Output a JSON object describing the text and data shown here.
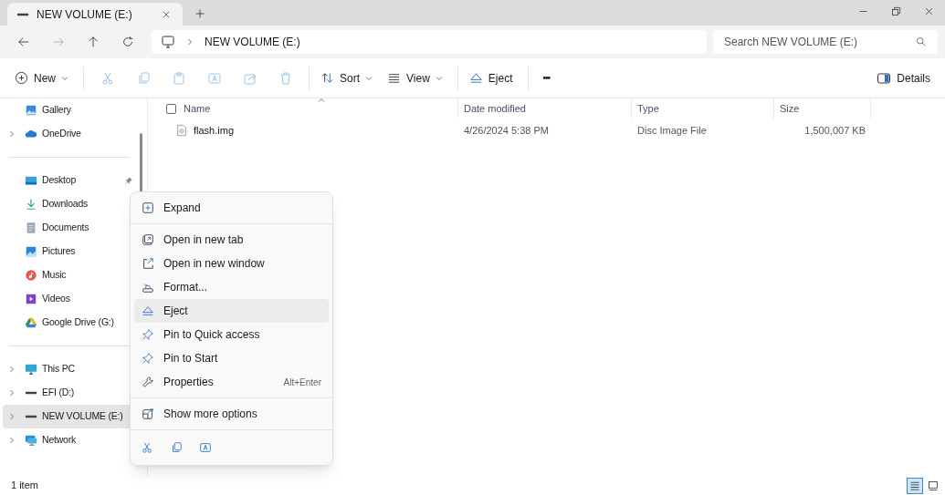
{
  "tabs": [
    {
      "label": "NEW VOLUME (E:)",
      "selected": true
    }
  ],
  "address": {
    "crumbs": [
      "NEW VOLUME (E:)"
    ]
  },
  "search": {
    "placeholder": "Search NEW VOLUME (E:)"
  },
  "toolbar": [
    {
      "kind": "labeled",
      "label": "New",
      "dropdown": true,
      "disabled": false
    },
    {
      "kind": "divider"
    },
    {
      "kind": "icon",
      "disabled": true
    },
    {
      "kind": "icon",
      "disabled": true
    },
    {
      "kind": "icon",
      "disabled": true
    },
    {
      "kind": "icon",
      "disabled": true
    },
    {
      "kind": "icon",
      "disabled": true
    },
    {
      "kind": "icon",
      "disabled": true
    },
    {
      "kind": "divider"
    },
    {
      "kind": "labeled",
      "label": "Sort",
      "dropdown": true,
      "disabled": false
    },
    {
      "kind": "labeled",
      "label": "View",
      "dropdown": true,
      "disabled": false
    },
    {
      "kind": "divider"
    },
    {
      "kind": "labeled",
      "label": "Eject",
      "dropdown": false,
      "disabled": false
    },
    {
      "kind": "divider"
    },
    {
      "kind": "more",
      "label": "•••"
    }
  ],
  "details_button": {
    "label": "Details"
  },
  "sidebar": {
    "groups": [
      [
        {
          "label": "Gallery",
          "expandable": false,
          "pinned": false,
          "selected": false
        },
        {
          "label": "OneDrive",
          "expandable": true,
          "pinned": false,
          "selected": false
        }
      ],
      [
        {
          "label": "Desktop",
          "expandable": false,
          "pinned": true,
          "selected": false
        },
        {
          "label": "Downloads",
          "expandable": false,
          "pinned": false,
          "selected": false
        },
        {
          "label": "Documents",
          "expandable": false,
          "pinned": false,
          "selected": false
        },
        {
          "label": "Pictures",
          "expandable": false,
          "pinned": false,
          "selected": false
        },
        {
          "label": "Music",
          "expandable": false,
          "pinned": false,
          "selected": false
        },
        {
          "label": "Videos",
          "expandable": false,
          "pinned": false,
          "selected": false
        },
        {
          "label": "Google Drive (G:)",
          "expandable": false,
          "pinned": false,
          "selected": false
        }
      ],
      [
        {
          "label": "This PC",
          "expandable": true,
          "pinned": false,
          "selected": false
        },
        {
          "label": "EFI (D:)",
          "expandable": true,
          "pinned": false,
          "selected": false
        },
        {
          "label": "NEW VOLUME (E:)",
          "expandable": true,
          "pinned": false,
          "selected": true
        },
        {
          "label": "Network",
          "expandable": true,
          "pinned": false,
          "selected": false
        }
      ]
    ]
  },
  "table": {
    "select_all_checked": false,
    "columns": [
      "Name",
      "Date modified",
      "Type",
      "Size"
    ],
    "rows": [
      {
        "name": "flash.img",
        "date": "4/26/2024 5:38 PM",
        "type": "Disc Image File",
        "size": "1,500,007 KB"
      }
    ]
  },
  "context_menu": {
    "sections": [
      [
        {
          "label": "Expand",
          "highlighted": false
        }
      ],
      [
        {
          "label": "Open in new tab",
          "highlighted": false
        },
        {
          "label": "Open in new window",
          "highlighted": false
        },
        {
          "label": "Format...",
          "highlighted": false
        },
        {
          "label": "Eject",
          "highlighted": true
        },
        {
          "label": "Pin to Quick access",
          "highlighted": false
        },
        {
          "label": "Pin to Start",
          "highlighted": false
        },
        {
          "label": "Properties",
          "shortcut": "Alt+Enter",
          "highlighted": false
        }
      ],
      [
        {
          "label": "Show more options",
          "highlighted": false
        }
      ]
    ]
  },
  "status_bar": {
    "text": "1 item",
    "views": [
      {
        "selected": true
      },
      {
        "selected": false
      }
    ]
  }
}
